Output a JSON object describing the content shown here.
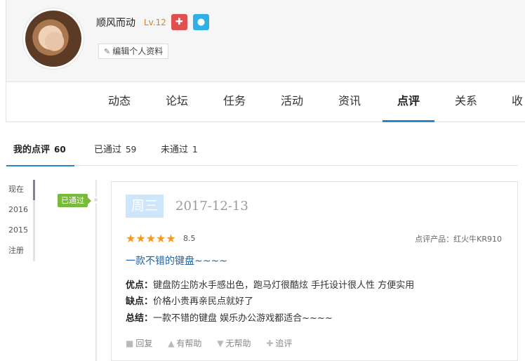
{
  "profile": {
    "username": "顺风而动",
    "level": "Lv.12",
    "badges": [
      {
        "icon": "gift-icon",
        "glyph": "🎁",
        "color": "#e05050"
      },
      {
        "icon": "water-drop-icon",
        "glyph": "💧",
        "color": "#32b0e6"
      }
    ],
    "edit_label": "编辑个人资料"
  },
  "nav": {
    "items": [
      "动态",
      "论坛",
      "任务",
      "活动",
      "资讯",
      "点评",
      "关系",
      "收藏"
    ],
    "active_index": 5,
    "accent": "#2a87c7"
  },
  "subtabs": {
    "mine": {
      "label": "我的点评",
      "count": "60"
    },
    "passed": {
      "label": "已通过",
      "count": "59"
    },
    "failed": {
      "label": "未通过",
      "count": "1"
    }
  },
  "timeline": [
    "现在",
    "2016",
    "2015",
    "注册"
  ],
  "review": {
    "status": "已通过",
    "status_color": "#79b93b",
    "day": "周三",
    "date": "2017-12-13",
    "stars": "★★★★★",
    "rating": 5,
    "score": "8.5",
    "product": "点评产品：红火牛KR910",
    "title": "一款不错的键盘~~~~",
    "pros_label": "优点：",
    "pros": "键盘防尘防水手感出色，跑马灯很酷炫 手托设计很人性 方便实用",
    "cons_label": "缺点：",
    "cons": "价格小贵再亲民点就好了",
    "summary_label": "总结：",
    "summary": "一款不错的键盘 娱乐办公游戏都适合~~~~",
    "actions": {
      "reply": "回复",
      "helpful": "有帮助",
      "unhelpful": "无帮助",
      "follow": "追评"
    }
  }
}
